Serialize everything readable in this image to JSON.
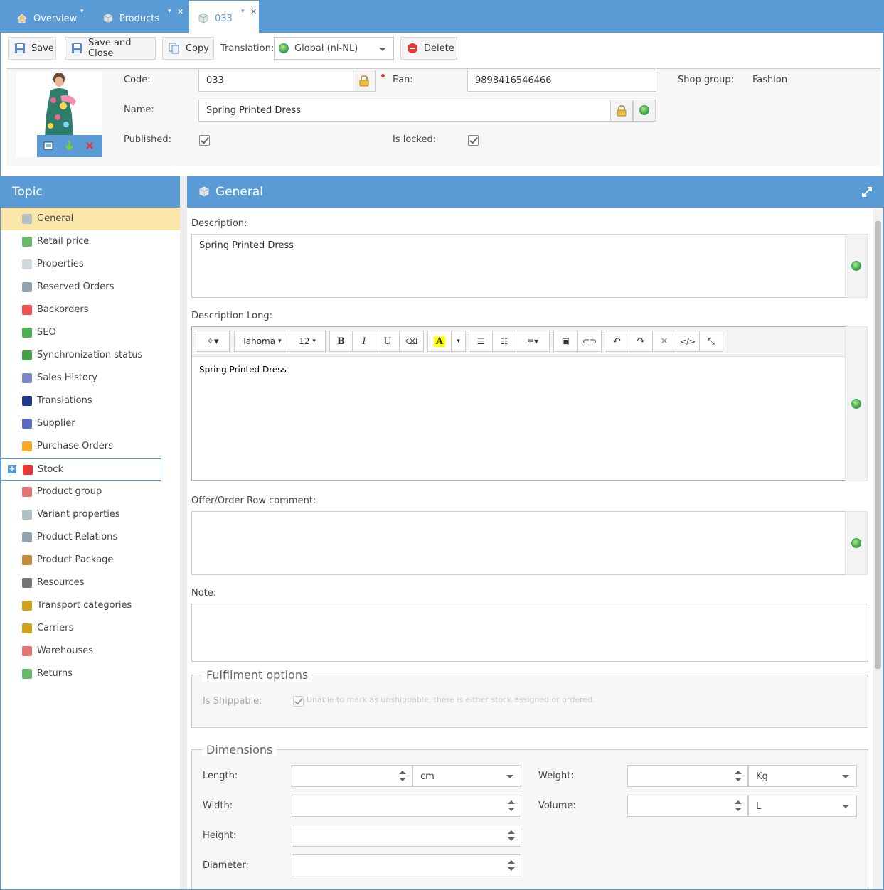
{
  "tabs": [
    {
      "label": "Overview",
      "icon": "home-icon"
    },
    {
      "label": "Products",
      "icon": "cube-icon"
    },
    {
      "label": "033",
      "icon": "cube-icon"
    }
  ],
  "toolbar": {
    "save_label": "Save",
    "save_close_label": "Save and Close",
    "copy_label": "Copy",
    "translation_label": "Translation:",
    "translation_value": "Global (nl-NL)",
    "delete_label": "Delete"
  },
  "product": {
    "code_label": "Code:",
    "code_value": "033",
    "ean_label": "Ean:",
    "ean_value": "9898416546466",
    "shop_group_label": "Shop group:",
    "shop_group_value": "Fashion",
    "name_label": "Name:",
    "name_value": "Spring Printed Dress",
    "published_label": "Published:",
    "locked_label": "Is locked:"
  },
  "topic_panel": {
    "title": "Topic",
    "items": [
      {
        "label": "General",
        "icon": "cube-icon",
        "color": "#b0bec5"
      },
      {
        "label": "Retail price",
        "icon": "money-icon",
        "color": "#66bb6a"
      },
      {
        "label": "Properties",
        "icon": "properties-icon",
        "color": "#cfd8dc"
      },
      {
        "label": "Reserved Orders",
        "icon": "cart-icon",
        "color": "#90a4ae"
      },
      {
        "label": "Backorders",
        "icon": "backorder-icon",
        "color": "#ef5350"
      },
      {
        "label": "SEO",
        "icon": "globe-icon",
        "color": "#4caf50"
      },
      {
        "label": "Synchronization status",
        "icon": "sync-icon",
        "color": "#43a047"
      },
      {
        "label": "Sales History",
        "icon": "chart-icon",
        "color": "#7986cb"
      },
      {
        "label": "Translations",
        "icon": "flag-icon",
        "color": "#1e3a8a"
      },
      {
        "label": "Supplier",
        "icon": "user-icon",
        "color": "#5c6bc0"
      },
      {
        "label": "Purchase Orders",
        "icon": "purchase-icon",
        "color": "#f9a825"
      },
      {
        "label": "Stock",
        "icon": "stock-icon",
        "color": "#e53935"
      },
      {
        "label": "Product group",
        "icon": "product-group-icon",
        "color": "#e57373"
      },
      {
        "label": "Variant properties",
        "icon": "variant-icon",
        "color": "#b0bec5"
      },
      {
        "label": "Product Relations",
        "icon": "relations-icon",
        "color": "#90a4ae"
      },
      {
        "label": "Product Package",
        "icon": "package-icon",
        "color": "#c68a3c"
      },
      {
        "label": "Resources",
        "icon": "paperclip-icon",
        "color": "#757575"
      },
      {
        "label": "Transport categories",
        "icon": "truck-icon",
        "color": "#d4a017"
      },
      {
        "label": "Carriers",
        "icon": "carrier-icon",
        "color": "#d4a017"
      },
      {
        "label": "Warehouses",
        "icon": "warehouse-icon",
        "color": "#e57373"
      },
      {
        "label": "Returns",
        "icon": "returns-icon",
        "color": "#66bb6a"
      }
    ]
  },
  "general": {
    "title": "General",
    "description_label": "Description:",
    "description_value": "Spring Printed Dress",
    "description_long_label": "Description Long:",
    "editor_font": "Tahoma",
    "editor_size": "12",
    "description_long_value": "Spring Printed Dress",
    "offer_comment_label": "Offer/Order Row comment:",
    "note_label": "Note:"
  },
  "fulfilment": {
    "legend": "Fulfilment options",
    "shippable_label": "Is Shippable:",
    "shippable_note": "Unable to mark as unshippable, there is either stock assigned or ordered."
  },
  "dimensions": {
    "legend": "Dimensions",
    "length_label": "Length:",
    "length_unit": "cm",
    "width_label": "Width:",
    "height_label": "Height:",
    "diameter_label": "Diameter:",
    "weight_label": "Weight:",
    "weight_unit": "Kg",
    "volume_label": "Volume:",
    "volume_unit": "L"
  }
}
